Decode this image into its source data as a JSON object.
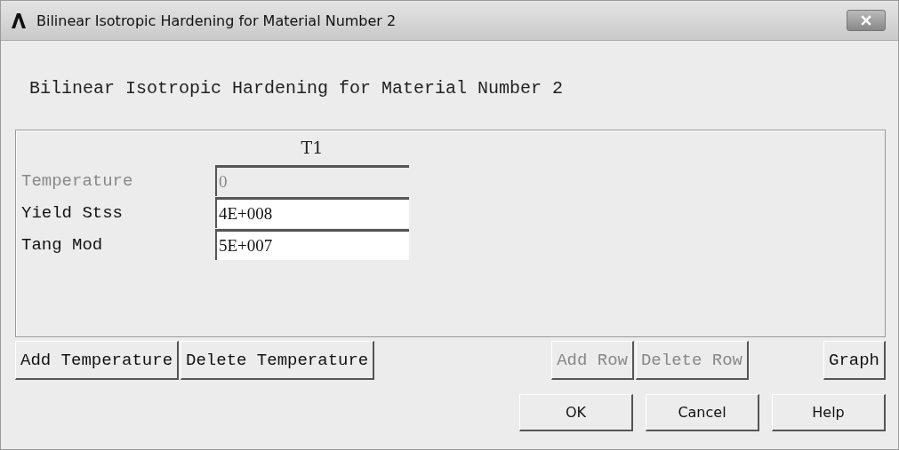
{
  "window": {
    "title": "Bilinear Isotropic Hardening for Material Number 2"
  },
  "heading": "Bilinear Isotropic Hardening for Material Number 2",
  "table": {
    "columns": [
      "T1"
    ],
    "rows": [
      {
        "label": "Temperature",
        "value": "0",
        "disabled": true
      },
      {
        "label": "Yield Stss",
        "value": "4E+008",
        "disabled": false
      },
      {
        "label": "Tang Mod",
        "value": "5E+007",
        "disabled": false
      }
    ]
  },
  "table_buttons": {
    "temperature": [
      {
        "label": "Add Temperature",
        "disabled": false
      },
      {
        "label": "Delete Temperature",
        "disabled": false
      }
    ],
    "row": [
      {
        "label": "Add Row",
        "disabled": true
      },
      {
        "label": "Delete Row",
        "disabled": true
      }
    ],
    "graph": {
      "label": "Graph",
      "disabled": false
    }
  },
  "dialog_buttons": [
    "OK",
    "Cancel",
    "Help"
  ]
}
